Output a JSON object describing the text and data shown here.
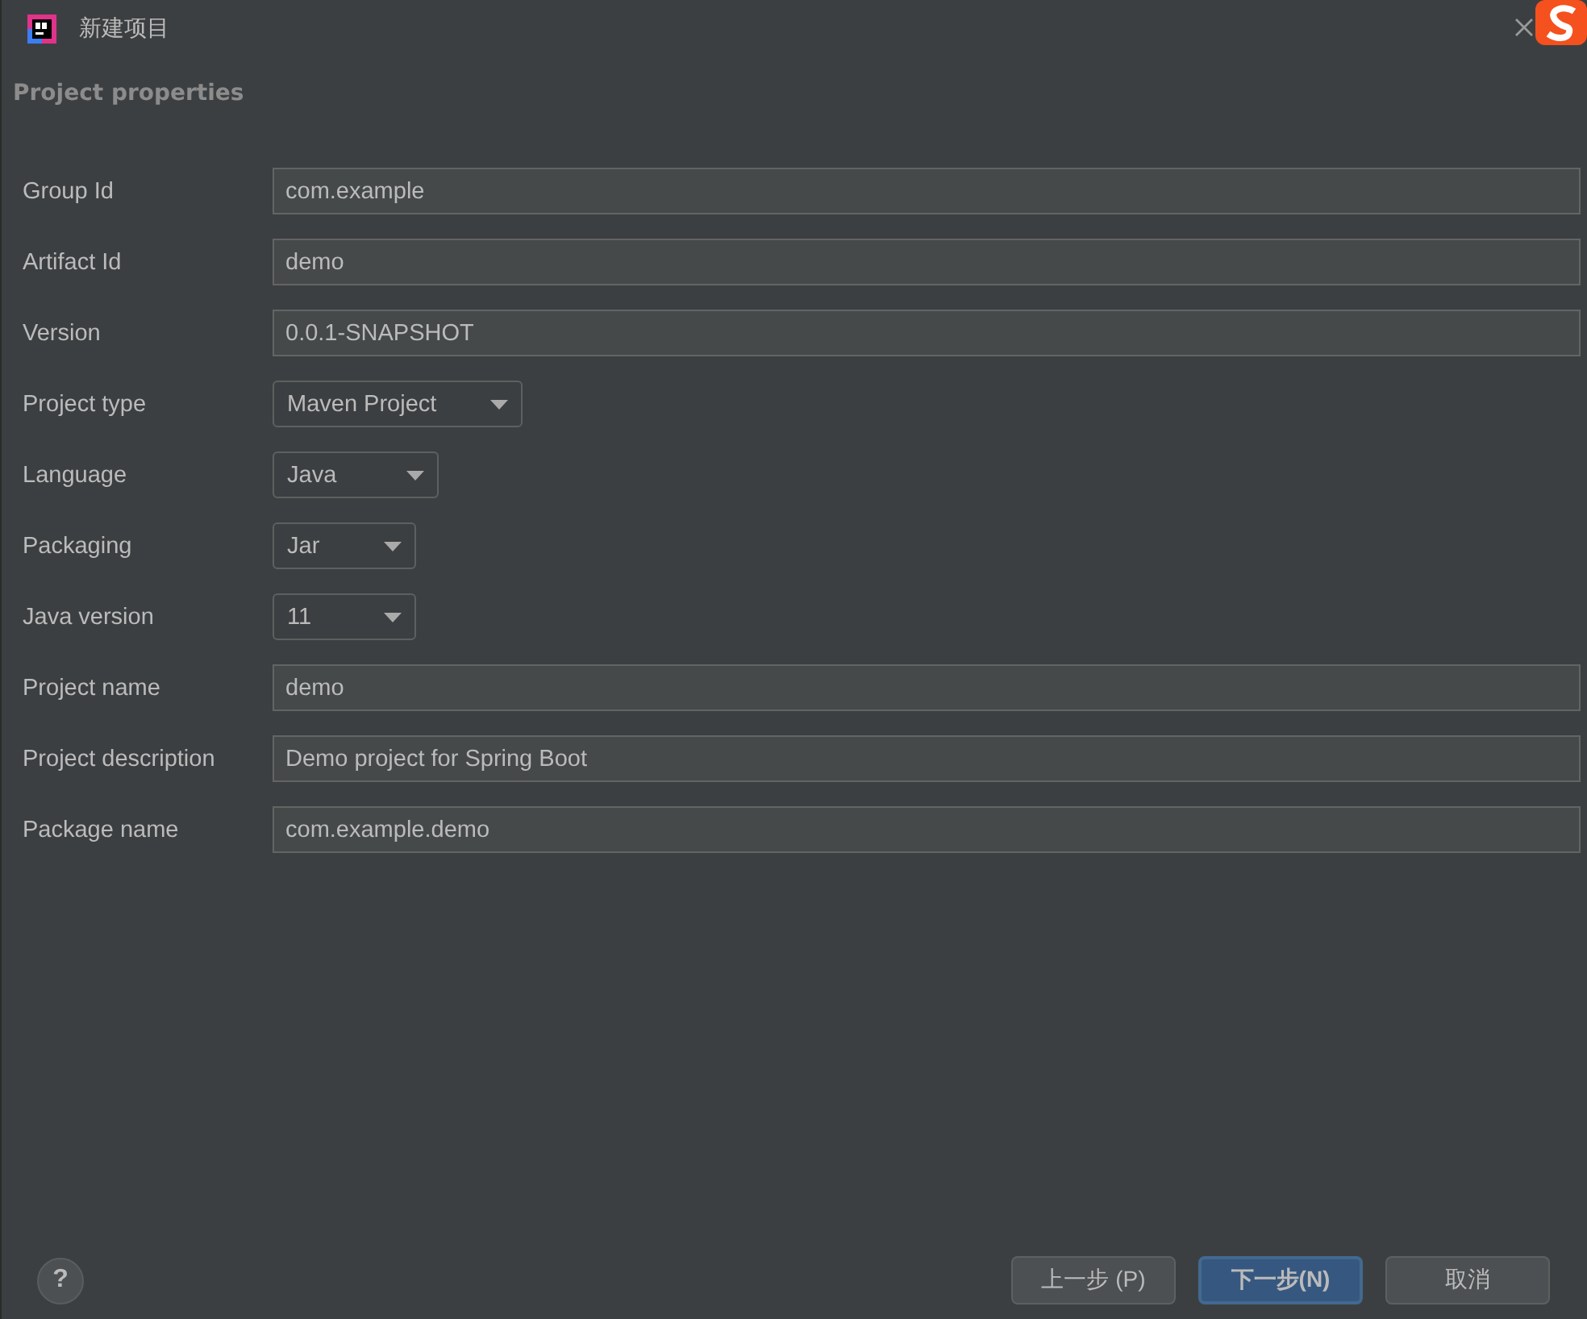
{
  "window": {
    "title": "新建项目"
  },
  "section_title": "Project properties",
  "fields": [
    {
      "kind": "text",
      "label": "Group Id",
      "value": "com.example"
    },
    {
      "kind": "text",
      "label": "Artifact Id",
      "value": "demo"
    },
    {
      "kind": "text",
      "label": "Version",
      "value": "0.0.1-SNAPSHOT"
    },
    {
      "kind": "dropdown",
      "label": "Project type",
      "value": "Maven Project"
    },
    {
      "kind": "dropdown",
      "label": "Language",
      "value": "Java"
    },
    {
      "kind": "dropdown",
      "label": "Packaging",
      "value": "Jar"
    },
    {
      "kind": "dropdown",
      "label": "Java version",
      "value": "11"
    },
    {
      "kind": "text",
      "label": "Project name",
      "value": "demo"
    },
    {
      "kind": "text",
      "label": "Project description",
      "value": "Demo project for Spring Boot"
    },
    {
      "kind": "text",
      "label": "Package name",
      "value": "com.example.demo"
    }
  ],
  "help": "?",
  "buttons": [
    {
      "label": "上一步 (P)",
      "primary": false
    },
    {
      "label": "下一步(N)",
      "primary": true
    },
    {
      "label": "取消",
      "primary": false
    }
  ]
}
